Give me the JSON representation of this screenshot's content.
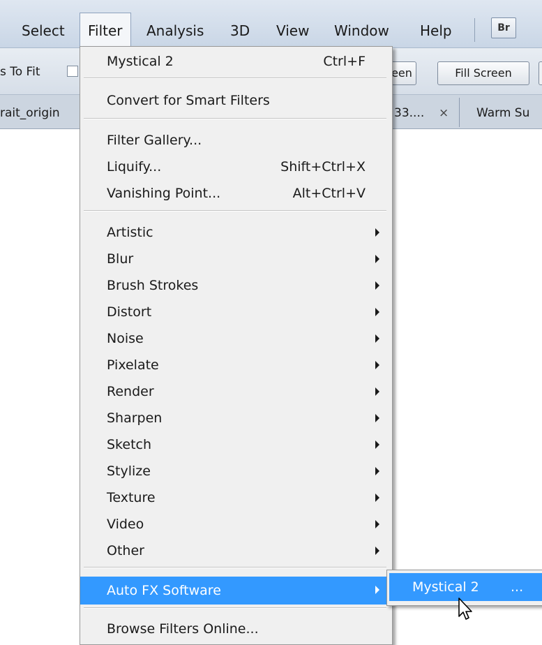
{
  "menubar": {
    "items": [
      "Select",
      "Filter",
      "Analysis",
      "3D",
      "View",
      "Window",
      "Help"
    ],
    "bridge_badge": "Br"
  },
  "options": {
    "fit_label": "s To Fit",
    "screen_btn": "een",
    "fill_screen_btn": "Fill Screen"
  },
  "tabs": {
    "doc1": "rait_origin",
    "doc2": "33....",
    "doc2_close": "×",
    "doc3": "Warm Su"
  },
  "filter_menu": {
    "last_filter": {
      "label": "Mystical 2",
      "shortcut": "Ctrl+F"
    },
    "convert": "Convert for Smart Filters",
    "gallery": "Filter Gallery...",
    "liquify": {
      "label": "Liquify...",
      "shortcut": "Shift+Ctrl+X"
    },
    "vanishing": {
      "label": "Vanishing Point...",
      "shortcut": "Alt+Ctrl+V"
    },
    "categories": [
      "Artistic",
      "Blur",
      "Brush Strokes",
      "Distort",
      "Noise",
      "Pixelate",
      "Render",
      "Sharpen",
      "Sketch",
      "Stylize",
      "Texture",
      "Video",
      "Other"
    ],
    "auto_fx": "Auto FX Software",
    "browse": "Browse Filters Online..."
  },
  "submenu": {
    "item": "Mystical 2",
    "ellipsis": "..."
  },
  "colors": {
    "highlight": "#3399ff",
    "menu_bg": "#f0f0f0"
  },
  "icons": {
    "submenu_arrow": "triangle-right",
    "cursor": "arrow-pointer"
  }
}
